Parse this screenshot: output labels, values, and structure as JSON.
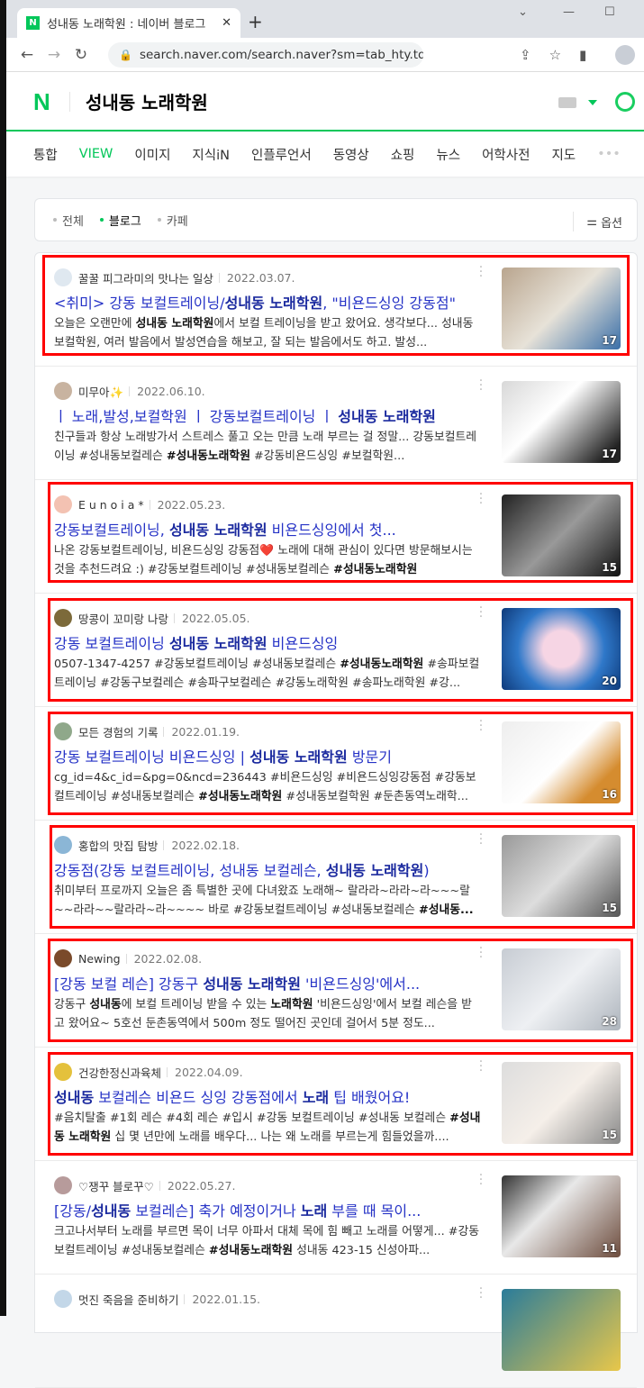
{
  "browser": {
    "tab_title": "성내동 노래학원 : 네이버 블로그",
    "favicon": "N",
    "url": "search.naver.com/search.naver?sm=tab_hty.top&where=blog&..."
  },
  "header": {
    "logo": "N",
    "query": "성내동 노래학원",
    "accent": "#03c75a"
  },
  "nav": [
    {
      "label": "통합"
    },
    {
      "label": "VIEW",
      "active": true
    },
    {
      "label": "이미지"
    },
    {
      "label": "지식iN"
    },
    {
      "label": "인플루언서"
    },
    {
      "label": "동영상"
    },
    {
      "label": "쇼핑"
    },
    {
      "label": "뉴스"
    },
    {
      "label": "어학사전"
    },
    {
      "label": "지도"
    }
  ],
  "filter": {
    "items": [
      {
        "label": "전체"
      },
      {
        "label": "블로그",
        "active": true
      },
      {
        "label": "카페"
      }
    ],
    "options_label": "옵션"
  },
  "highlight_color": "#ff0000",
  "results": [
    {
      "author": "꿀꿀 피그라미의 맛나는 일상",
      "date": "2022.03.07.",
      "highlighted": true,
      "count": "17",
      "title": [
        {
          "t": "<취미> 강동 보컬트레이닝/"
        },
        {
          "t": "성내동 노래학원",
          "b": 1
        },
        {
          "t": ", \"비욘드싱잉 강동점\""
        }
      ],
      "desc": [
        {
          "t": "오늘은 오랜만에 "
        },
        {
          "t": "성내동 노래학원",
          "b": 1
        },
        {
          "t": "에서 보컬 트레이닝을 받고 왔어요. 생각보다... 성내동 보컬학원, 여러 발음에서 발성연습을 해보고, 잘 되는 발음에서도 하고. 발성..."
        }
      ]
    },
    {
      "author": "미무아✨",
      "date": "2022.06.10.",
      "highlighted": false,
      "count": "17",
      "title": [
        {
          "t": "ㅣ 노래,발성,보컬학원 ㅣ 강동보컬트레이닝 ㅣ "
        },
        {
          "t": "성내동 노래학원",
          "b": 1
        }
      ],
      "desc": [
        {
          "t": "친구들과 항상 노래방가서 스트레스 풀고 오는 만큼 노래 부르는 걸 정말... 강동보컬트레이닝 #성내동보컬레슨 "
        },
        {
          "t": "#성내동노래학원",
          "b": 1
        },
        {
          "t": " #강동비욘드싱잉 #보컬학원..."
        }
      ]
    },
    {
      "author": "E u n o i a *",
      "date": "2022.05.23.",
      "highlighted": true,
      "count": "15",
      "title": [
        {
          "t": "강동보컬트레이닝, "
        },
        {
          "t": "성내동 노래학원",
          "b": 1
        },
        {
          "t": " 비욘드싱잉에서 첫..."
        }
      ],
      "desc": [
        {
          "t": "나온 강동보컬트레이닝, 비욘드싱잉 강동점❤️ 노래에 대해 관심이 있다면 방문해보시는 것을 추천드려요 :) #강동보컬트레이닝 #성내동보컬레슨 "
        },
        {
          "t": "#성내동노래학원",
          "b": 1
        }
      ]
    },
    {
      "author": "땅콩이 꼬미랑 나랑",
      "date": "2022.05.05.",
      "highlighted": true,
      "count": "20",
      "title": [
        {
          "t": "강동 보컬트레이닝 "
        },
        {
          "t": "성내동 노래학원",
          "b": 1
        },
        {
          "t": " 비욘드싱잉"
        }
      ],
      "desc": [
        {
          "t": "0507-1347-4257 #강동보컬트레이닝 #성내동보컬레슨 "
        },
        {
          "t": "#성내동노래학원",
          "b": 1
        },
        {
          "t": " #송파보컬트레이닝 #강동구보컬레슨 #송파구보컬레슨 #강동노래학원 #송파노래학원 #강..."
        }
      ]
    },
    {
      "author": "모든 경험의 기록",
      "date": "2022.01.19.",
      "highlighted": true,
      "count": "16",
      "title": [
        {
          "t": "강동 보컬트레이닝 비욘드싱잉 | "
        },
        {
          "t": "성내동 노래학원",
          "b": 1
        },
        {
          "t": " 방문기"
        }
      ],
      "desc": [
        {
          "t": "cg_id=4&c_id=&pg=0&ncd=236443 #비욘드싱잉 #비욘드싱잉강동점 #강동보컬트레이닝 #성내동보컬레슨 "
        },
        {
          "t": "#성내동노래학원",
          "b": 1
        },
        {
          "t": " #성내동보컬학원 #둔촌동역노래학..."
        }
      ]
    },
    {
      "author": "홍합의 맛집 탐방",
      "date": "2022.02.18.",
      "highlighted": true,
      "count": "15",
      "title": [
        {
          "t": "강동점(강동 보컬트레이닝, 성내동 보컬레슨, "
        },
        {
          "t": "성내동 노래학원",
          "b": 1
        },
        {
          "t": ")"
        }
      ],
      "desc": [
        {
          "t": "취미부터 프로까지 오늘은 좀 특별한 곳에 다녀왔죠 노래해~ 랄라라~라라~라~~~랄~~라라~~랄라라~라~~~~ 바로 #강동보컬트레이닝 #성내동보컬레슨 "
        },
        {
          "t": "#성내동...",
          "b": 1
        }
      ]
    },
    {
      "author": "Newing",
      "date": "2022.02.08.",
      "highlighted": true,
      "count": "28",
      "title": [
        {
          "t": "[강동 보컬 레슨] 강동구 "
        },
        {
          "t": "성내동 노래학원",
          "b": 1
        },
        {
          "t": " '비욘드싱잉'에서..."
        }
      ],
      "desc": [
        {
          "t": "강동구 "
        },
        {
          "t": "성내동",
          "b": 1
        },
        {
          "t": "에 보컬 트레이닝 받을 수 있는 "
        },
        {
          "t": "노래학원",
          "b": 1
        },
        {
          "t": " '비욘드싱잉'에서 보컬 레슨을 받고 왔어요~ 5호선 둔촌동역에서 500m 정도 떨어진 곳인데 걸어서 5분 정도..."
        }
      ]
    },
    {
      "author": "건강한정신과육체",
      "date": "2022.04.09.",
      "highlighted": true,
      "count": "15",
      "title": [
        {
          "t": "성내동",
          "b": 1
        },
        {
          "t": " 보컬레슨 비욘드 싱잉 강동점에서 "
        },
        {
          "t": "노래",
          "b": 1
        },
        {
          "t": " 팁 배웠어요!"
        }
      ],
      "desc": [
        {
          "t": "#음치탈출 #1회 레슨 #4회 레슨 #입시 #강동 보컬트레이닝 #성내동 보컬레슨 "
        },
        {
          "t": "#성내동 노래학원",
          "b": 1
        },
        {
          "t": " 십 몇 년만에 노래를 배우다... 나는 왜 노래를 부르는게 힘들었을까...."
        }
      ]
    },
    {
      "author": "♡쟁꾸 블로꾸♡",
      "date": "2022.05.27.",
      "highlighted": false,
      "count": "11",
      "title": [
        {
          "t": "[강동/"
        },
        {
          "t": "성내동",
          "b": 1
        },
        {
          "t": " 보컬레슨] 축가 예정이거나 "
        },
        {
          "t": "노래",
          "b": 1
        },
        {
          "t": " 부를 때 목이..."
        }
      ],
      "desc": [
        {
          "t": "크고나서부터 노래를 부르면 목이 너무 아파서 대체 목에 힘 빼고 노래를 어떻게... #강동보컬트레이닝 #성내동보컬레슨 "
        },
        {
          "t": "#성내동노래학원",
          "b": 1
        },
        {
          "t": " 성내동 423-15 신성아파..."
        }
      ]
    },
    {
      "author": "멋진 죽음을 준비하기",
      "date": "2022.01.15.",
      "highlighted": false,
      "count": "",
      "title": [],
      "desc": []
    }
  ]
}
